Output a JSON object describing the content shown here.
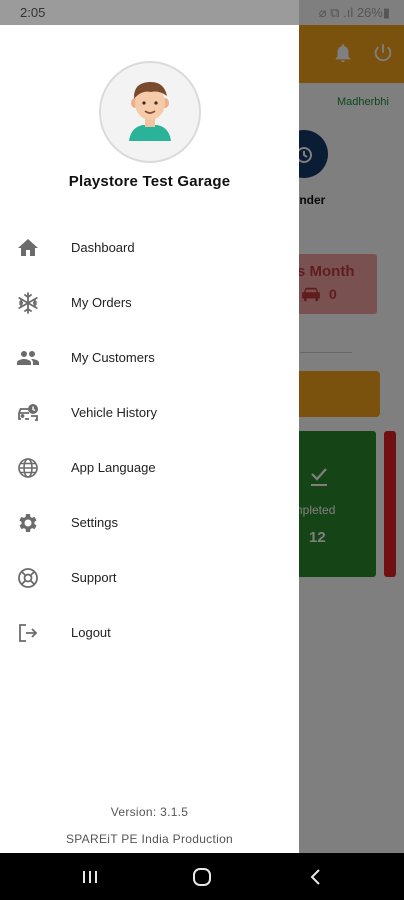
{
  "status_bar": {
    "time": "2:05",
    "indicators": "⌀ ⧉ .ıl 26%▮"
  },
  "background_app": {
    "location": "Madherbhi",
    "reminder_label": "inder",
    "month_label": "s Month",
    "month_count": "0",
    "completed_label": "ompleted",
    "completed_count": "12",
    "colors": {
      "appbar": "#f5a21b",
      "green_card": "#2a8a2c",
      "red": "#e02020"
    }
  },
  "drawer": {
    "avatar_icon": "boy-avatar",
    "garage_name": "Playstore Test Garage",
    "menu": [
      {
        "label": "Dashboard",
        "icon": "home-icon"
      },
      {
        "label": "My Orders",
        "icon": "snowflake-icon"
      },
      {
        "label": "My Customers",
        "icon": "people-icon"
      },
      {
        "label": "Vehicle History",
        "icon": "vehicle-history-icon"
      },
      {
        "label": "App Language",
        "icon": "globe-icon"
      },
      {
        "label": "Settings",
        "icon": "gear-icon"
      },
      {
        "label": "Support",
        "icon": "lifebuoy-icon"
      },
      {
        "label": "Logout",
        "icon": "logout-icon"
      }
    ],
    "version": "Version: 3.1.5",
    "company": "SPAREiT PE India Production"
  },
  "nav_bar": {
    "buttons": [
      "recents-icon",
      "home-circle-icon",
      "back-icon"
    ]
  }
}
